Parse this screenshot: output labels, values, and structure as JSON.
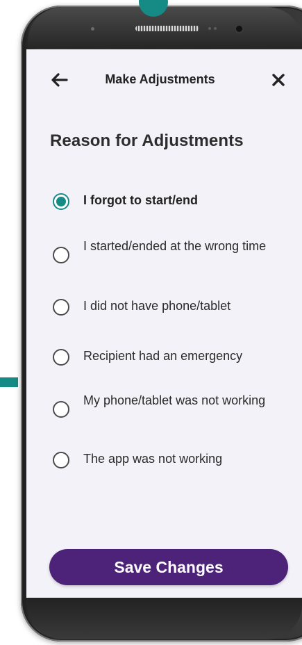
{
  "header": {
    "title": "Make Adjustments",
    "back_icon": "arrow-left-icon",
    "close_icon": "close-icon"
  },
  "section": {
    "title": "Reason for Adjustments"
  },
  "options": [
    {
      "label": "I forgot to start/end",
      "selected": true
    },
    {
      "label": "I started/ended at the wrong time",
      "selected": false
    },
    {
      "label": "I did not have phone/tablet",
      "selected": false
    },
    {
      "label": "Recipient had an emergency",
      "selected": false
    },
    {
      "label": "My phone/tablet was not working",
      "selected": false
    },
    {
      "label": "The app was not working",
      "selected": false
    }
  ],
  "actions": {
    "save_label": "Save Changes"
  },
  "colors": {
    "accent": "#168b86",
    "primary_button": "#4d2279",
    "screen_background": "#f3f2f8"
  }
}
